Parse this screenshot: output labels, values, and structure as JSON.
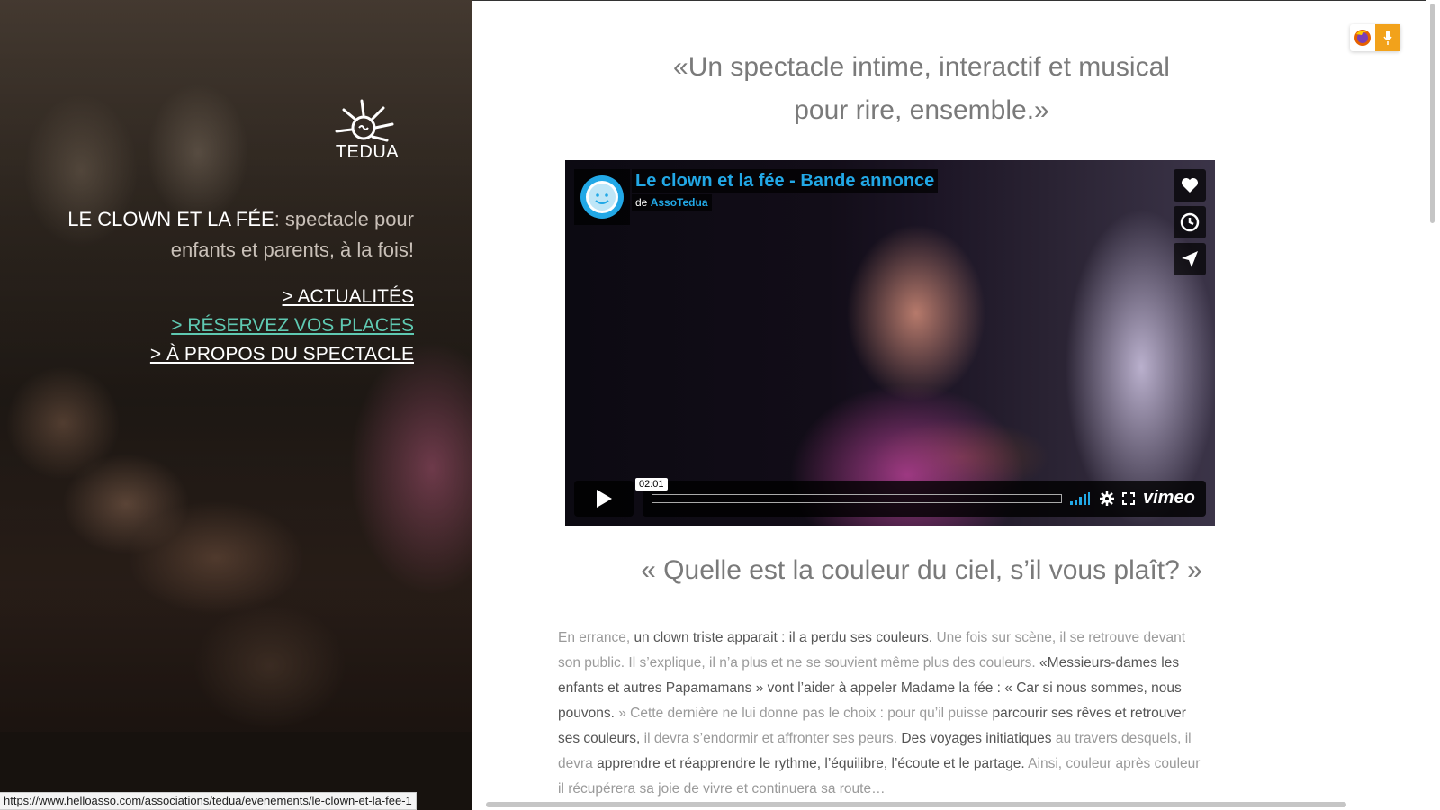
{
  "sidebar": {
    "logo_text": "TEDUA",
    "tagline_strong": "LE CLOWN ET LA FÉE",
    "tagline_rest": ": spectacle pour enfants et parents, à la fois!",
    "menu": [
      {
        "label": "> ACTUALITÉS"
      },
      {
        "label": "> RÉSERVEZ VOS PLACES"
      },
      {
        "label": "> À PROPOS DU SPECTACLE"
      }
    ],
    "accent_color": "#5fc9b2"
  },
  "main": {
    "quote_line1": "«Un spectacle intime, interactif et musical",
    "quote_line2": "pour rire, ensemble.»",
    "video": {
      "title": "Le clown et la fée - Bande annonce",
      "by_prefix": "de",
      "by_user": "AssoTedua",
      "time": "02:01",
      "brand": "vimeo",
      "title_color": "#22a8e6"
    },
    "subtitle": "« Quelle est la couleur du ciel, s’il vous plaît? »",
    "paragraph": [
      {
        "t": "En errance, ",
        "hl": false
      },
      {
        "t": "un clown triste apparait : il a perdu ses couleurs.",
        "hl": true
      },
      {
        "t": " Une fois sur scène, il se retrouve devant son public. Il s’explique, il n’a plus et ne se souvient même plus des couleurs. ",
        "hl": false
      },
      {
        "t": "«Messieurs-dames les enfants et autres Papamamans » vont l’aider à appeler Madame la fée : « Car si nous sommes, nous pouvons.",
        "hl": true
      },
      {
        "t": " » Cette dernière ne lui donne pas le choix : pour qu’il puisse ",
        "hl": false
      },
      {
        "t": "parcourir ses rêves et retrouver ses couleurs,",
        "hl": true
      },
      {
        "t": " il devra s’endormir et affronter ses peurs. ",
        "hl": false
      },
      {
        "t": "Des voyages initiatiques",
        "hl": true
      },
      {
        "t": " au travers desquels, il devra ",
        "hl": false
      },
      {
        "t": "apprendre et réapprendre le rythme, l’équilibre, l’écoute et le partage.",
        "hl": true
      },
      {
        "t": " Ainsi, couleur après couleur il récupérera sa joie de vivre et continuera sa route…",
        "hl": false
      }
    ]
  },
  "browser": {
    "status_url": "https://www.helloasso.com/associations/tedua/evenements/le-clown-et-la-fee-1",
    "extension_icons": [
      "firefox-icon",
      "microphone-icon"
    ]
  }
}
